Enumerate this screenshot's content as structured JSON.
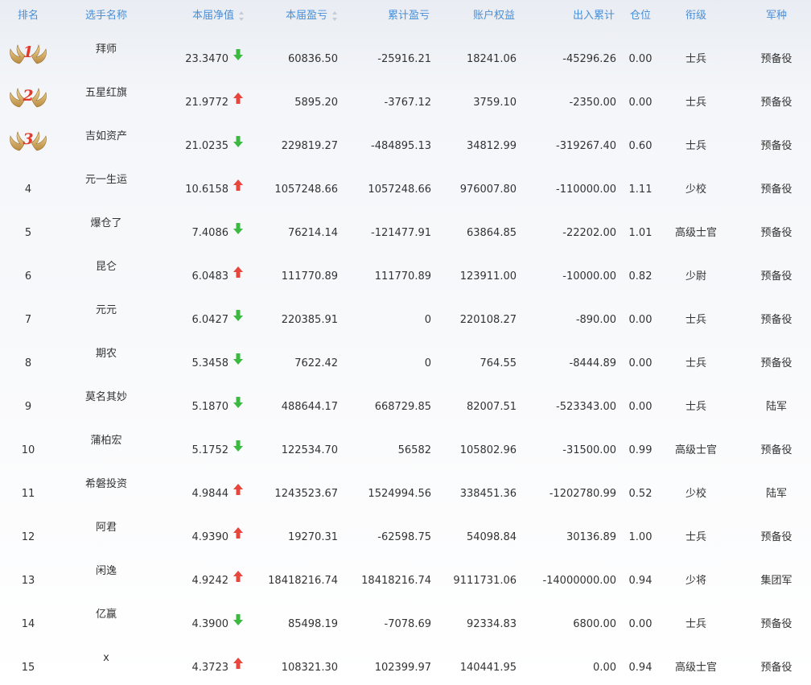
{
  "columns": {
    "rank": "排名",
    "name": "选手名称",
    "nav": "本届净值",
    "pnl": "本届盈亏",
    "cum_pnl": "累计盈亏",
    "equity": "账户权益",
    "inout": "出入累计",
    "position": "仓位",
    "title": "衔级",
    "arm": "军种"
  },
  "colors": {
    "header_text": "#4a8fd6",
    "up_arrow": "#e8453c",
    "down_arrow": "#3cb940",
    "medal_number": "#e23a2a"
  },
  "rows": [
    {
      "rank": "1",
      "medal": true,
      "name": "拜师",
      "nav": "23.3470",
      "trend": "down",
      "pnl": "60836.50",
      "cum_pnl": "-25916.21",
      "equity": "18241.06",
      "inout": "-45296.26",
      "position": "0.00",
      "title": "士兵",
      "arm": "预备役"
    },
    {
      "rank": "2",
      "medal": true,
      "name": "五星红旗",
      "nav": "21.9772",
      "trend": "up",
      "pnl": "5895.20",
      "cum_pnl": "-3767.12",
      "equity": "3759.10",
      "inout": "-2350.00",
      "position": "0.00",
      "title": "士兵",
      "arm": "预备役"
    },
    {
      "rank": "3",
      "medal": true,
      "name": "吉如资产",
      "nav": "21.0235",
      "trend": "down",
      "pnl": "229819.27",
      "cum_pnl": "-484895.13",
      "equity": "34812.99",
      "inout": "-319267.40",
      "position": "0.60",
      "title": "士兵",
      "arm": "预备役"
    },
    {
      "rank": "4",
      "medal": false,
      "name": "元一生运",
      "nav": "10.6158",
      "trend": "up",
      "pnl": "1057248.66",
      "cum_pnl": "1057248.66",
      "equity": "976007.80",
      "inout": "-110000.00",
      "position": "1.11",
      "title": "少校",
      "arm": "预备役"
    },
    {
      "rank": "5",
      "medal": false,
      "name": "爆仓了",
      "nav": "7.4086",
      "trend": "down",
      "pnl": "76214.14",
      "cum_pnl": "-121477.91",
      "equity": "63864.85",
      "inout": "-22202.00",
      "position": "1.01",
      "title": "高级士官",
      "arm": "预备役"
    },
    {
      "rank": "6",
      "medal": false,
      "name": "昆仑",
      "nav": "6.0483",
      "trend": "up",
      "pnl": "111770.89",
      "cum_pnl": "111770.89",
      "equity": "123911.00",
      "inout": "-10000.00",
      "position": "0.82",
      "title": "少尉",
      "arm": "预备役"
    },
    {
      "rank": "7",
      "medal": false,
      "name": "元元",
      "nav": "6.0427",
      "trend": "down",
      "pnl": "220385.91",
      "cum_pnl": "0",
      "equity": "220108.27",
      "inout": "-890.00",
      "position": "0.00",
      "title": "士兵",
      "arm": "预备役"
    },
    {
      "rank": "8",
      "medal": false,
      "name": "期农",
      "nav": "5.3458",
      "trend": "down",
      "pnl": "7622.42",
      "cum_pnl": "0",
      "equity": "764.55",
      "inout": "-8444.89",
      "position": "0.00",
      "title": "士兵",
      "arm": "预备役"
    },
    {
      "rank": "9",
      "medal": false,
      "name": "莫名其妙",
      "nav": "5.1870",
      "trend": "down",
      "pnl": "488644.17",
      "cum_pnl": "668729.85",
      "equity": "82007.51",
      "inout": "-523343.00",
      "position": "0.00",
      "title": "士兵",
      "arm": "陆军"
    },
    {
      "rank": "10",
      "medal": false,
      "name": "蒲柏宏",
      "nav": "5.1752",
      "trend": "down",
      "pnl": "122534.70",
      "cum_pnl": "56582",
      "equity": "105802.96",
      "inout": "-31500.00",
      "position": "0.99",
      "title": "高级士官",
      "arm": "预备役"
    },
    {
      "rank": "11",
      "medal": false,
      "name": "希磐投资",
      "nav": "4.9844",
      "trend": "up",
      "pnl": "1243523.67",
      "cum_pnl": "1524994.56",
      "equity": "338451.36",
      "inout": "-1202780.99",
      "position": "0.52",
      "title": "少校",
      "arm": "陆军"
    },
    {
      "rank": "12",
      "medal": false,
      "name": "阿君",
      "nav": "4.9390",
      "trend": "up",
      "pnl": "19270.31",
      "cum_pnl": "-62598.75",
      "equity": "54098.84",
      "inout": "30136.89",
      "position": "1.00",
      "title": "士兵",
      "arm": "预备役"
    },
    {
      "rank": "13",
      "medal": false,
      "name": "闲逸",
      "nav": "4.9242",
      "trend": "up",
      "pnl": "18418216.74",
      "cum_pnl": "18418216.74",
      "equity": "9111731.06",
      "inout": "-14000000.00",
      "position": "0.94",
      "title": "少将",
      "arm": "集团军"
    },
    {
      "rank": "14",
      "medal": false,
      "name": "亿赢",
      "nav": "4.3900",
      "trend": "down",
      "pnl": "85498.19",
      "cum_pnl": "-7078.69",
      "equity": "92334.83",
      "inout": "6800.00",
      "position": "0.00",
      "title": "士兵",
      "arm": "预备役"
    },
    {
      "rank": "15",
      "medal": false,
      "name": "x",
      "nav": "4.3723",
      "trend": "up",
      "pnl": "108321.30",
      "cum_pnl": "102399.97",
      "equity": "140441.95",
      "inout": "0.00",
      "position": "0.94",
      "title": "高级士官",
      "arm": "预备役"
    }
  ]
}
